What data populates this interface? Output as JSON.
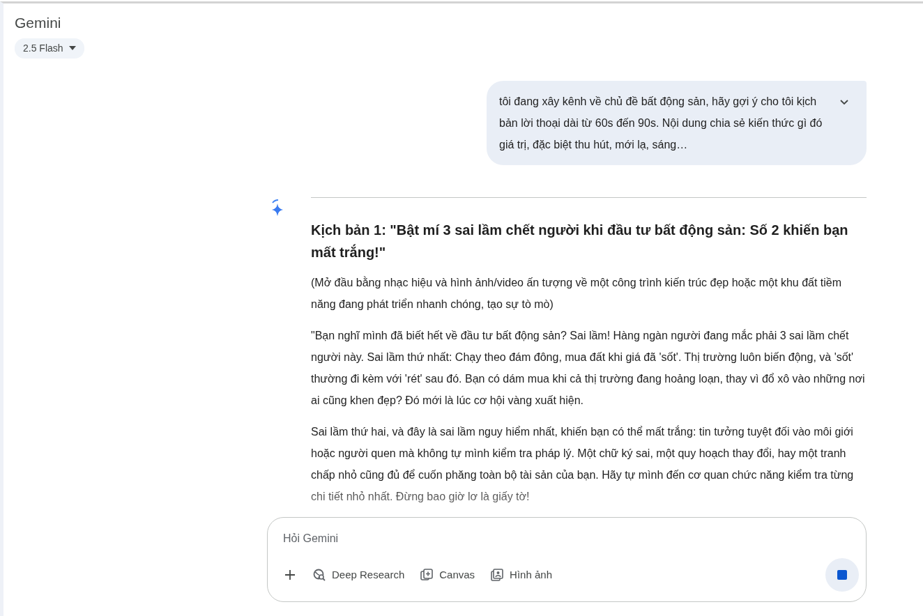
{
  "header": {
    "title": "Gemini",
    "model": "2.5 Flash"
  },
  "user_message": {
    "text": "tôi đang xây kênh về chủ đề bất động sản, hãy gợi ý cho tôi kịch bản lời thoại dài từ 60s đến 90s. Nội dung chia sẻ kiến thức gì đó giá trị, đặc biệt thu hút, mới lạ, sáng…",
    "expanded": false
  },
  "response": {
    "heading": "Kịch bản 1: \"Bật mí 3 sai lầm chết người khi đầu tư bất động sản: Số 2 khiến bạn mất trắng!\"",
    "paragraphs": [
      "(Mở đầu bằng nhạc hiệu và hình ảnh/video ấn tượng về một công trình kiến trúc đẹp hoặc một khu đất tiềm năng đang phát triển nhanh chóng, tạo sự tò mò)",
      "\"Bạn nghĩ mình đã biết hết về đầu tư bất động sản? Sai lầm! Hàng ngàn người đang mắc phải 3 sai lầm chết người này. Sai lầm thứ nhất: Chạy theo đám đông, mua đất khi giá đã 'sốt'. Thị trường luôn biến động, và 'sốt' thường đi kèm với 'rét' sau đó. Bạn có dám mua khi cả thị trường đang hoảng loạn, thay vì đổ xô vào những nơi ai cũng khen đẹp? Đó mới là lúc cơ hội vàng xuất hiện.",
      "Sai lầm thứ hai, và đây là sai lầm nguy hiểm nhất, khiến bạn có thể mất trắng: tin tưởng tuyệt đối vào môi giới hoặc người quen mà không tự mình kiểm tra pháp lý. Một chữ ký sai, một quy hoạch thay đổi, hay một tranh chấp nhỏ cũng đủ để cuốn phăng toàn bộ tài sản của bạn. Hãy tự mình đến cơ quan chức năng kiểm tra từng chi tiết nhỏ nhất. Đừng bao giờ lơ là giấy tờ!"
    ]
  },
  "composer": {
    "placeholder": "Hỏi Gemini",
    "tools": [
      {
        "kind": "plus"
      },
      {
        "kind": "research",
        "label": "Deep Research"
      },
      {
        "kind": "canvas",
        "label": "Canvas"
      },
      {
        "kind": "image",
        "label": "Hình ảnh"
      }
    ],
    "generating": true
  }
}
